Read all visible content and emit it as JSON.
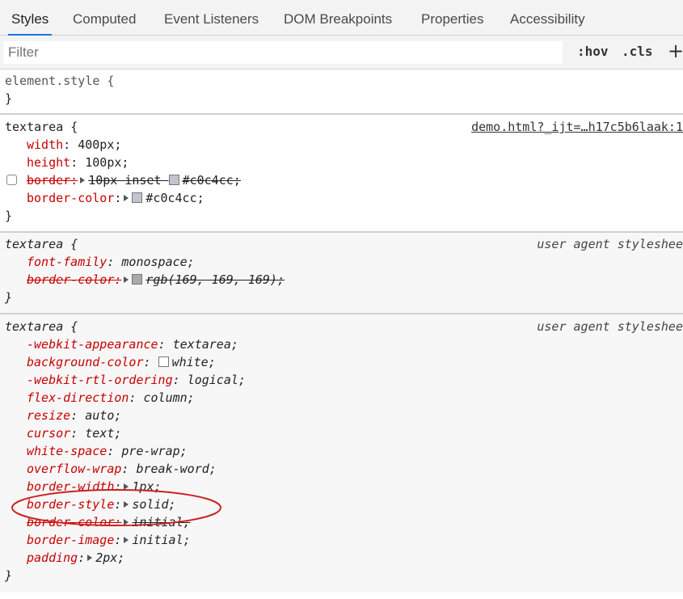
{
  "tabs": [
    "Styles",
    "Computed",
    "Event Listeners",
    "DOM Breakpoints",
    "Properties",
    "Accessibility"
  ],
  "filter": {
    "placeholder": "Filter",
    "hov": ":hov",
    "cls": ".cls",
    "add": "+"
  },
  "rules": [
    {
      "selector": "element.style {",
      "close": "}"
    },
    {
      "selector": "textarea {",
      "source": "demo.html?_ijt=…h17c5b6laak:1",
      "close": "}",
      "decls": [
        {
          "name": "width",
          "value": "400px;"
        },
        {
          "name": "height",
          "value": "100px;"
        },
        {
          "name": "border:",
          "value": "10px inset",
          "value2": "#c0c4cc;"
        },
        {
          "name": "border-color",
          "value": "#c0c4cc;"
        }
      ]
    },
    {
      "selector": "textarea {",
      "source": "user agent styleshee",
      "close": "}",
      "decls": [
        {
          "name": "font-family",
          "value": "monospace;"
        },
        {
          "name": "border-color:",
          "value": "rgb(169, 169, 169);"
        }
      ]
    },
    {
      "selector": "textarea {",
      "source": "user agent styleshee",
      "close": "}",
      "decls": [
        {
          "name": "-webkit-appearance",
          "value": "textarea;"
        },
        {
          "name": "background-color",
          "value": "white;"
        },
        {
          "name": "-webkit-rtl-ordering",
          "value": "logical;"
        },
        {
          "name": "flex-direction",
          "value": "column;"
        },
        {
          "name": "resize",
          "value": "auto;"
        },
        {
          "name": "cursor",
          "value": "text;"
        },
        {
          "name": "white-space",
          "value": "pre-wrap;"
        },
        {
          "name": "overflow-wrap",
          "value": "break-word;"
        },
        {
          "name": "border-width",
          "value": "1px;"
        },
        {
          "name": "border-style",
          "value": "solid;"
        },
        {
          "name": "border-color:",
          "value": "initial;"
        },
        {
          "name": "border-image",
          "value": "initial;"
        },
        {
          "name": "padding",
          "value": "2px;"
        }
      ]
    }
  ],
  "colors": {
    "accent": "#1a73e8",
    "property": "#c80000",
    "swatch_c0c4cc": "#c0c4cc",
    "swatch_a9a9a9": "#a9a9a9",
    "swatch_white": "#ffffff",
    "annotation": "#cc2222"
  }
}
